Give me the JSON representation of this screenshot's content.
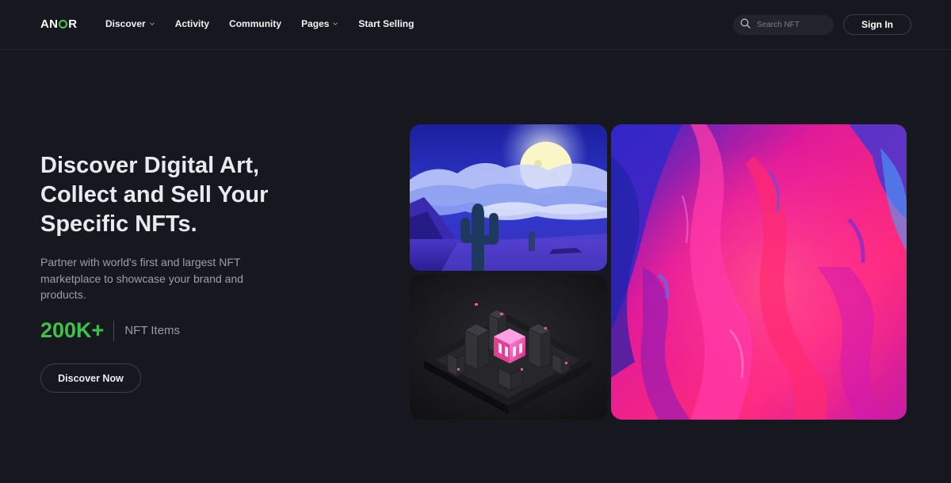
{
  "header": {
    "logo": {
      "text_pre": "AN",
      "text_post": "R",
      "accent": "#3ecf4c"
    },
    "nav": [
      {
        "label": "Discover",
        "has_dropdown": true
      },
      {
        "label": "Activity",
        "has_dropdown": false
      },
      {
        "label": "Community",
        "has_dropdown": false
      },
      {
        "label": "Pages",
        "has_dropdown": true
      },
      {
        "label": "Start Selling",
        "has_dropdown": false
      }
    ],
    "search": {
      "placeholder": "Search NFT",
      "value": "",
      "icon": "search-icon"
    },
    "signin_label": "Sign In"
  },
  "hero": {
    "title_line1": "Discover Digital Art,",
    "title_line2": "Collect and Sell Your",
    "title_line3": "Specific NFTs.",
    "subtitle": "Partner with world's first and largest NFT marketplace to showcase your brand and products.",
    "stat_value": "200K+",
    "stat_label": "NFT Items",
    "cta_label": "Discover Now"
  },
  "colors": {
    "background": "#17181f",
    "accent_green": "#3fc24a",
    "text_primary": "#e9e9ee",
    "text_muted": "#9c9da6"
  },
  "gallery": [
    {
      "name": "night-desert-artwork",
      "description_icon": "image"
    },
    {
      "name": "isometric-city-artwork",
      "description_icon": "image"
    },
    {
      "name": "abstract-fluid-artwork",
      "description_icon": "image"
    }
  ]
}
